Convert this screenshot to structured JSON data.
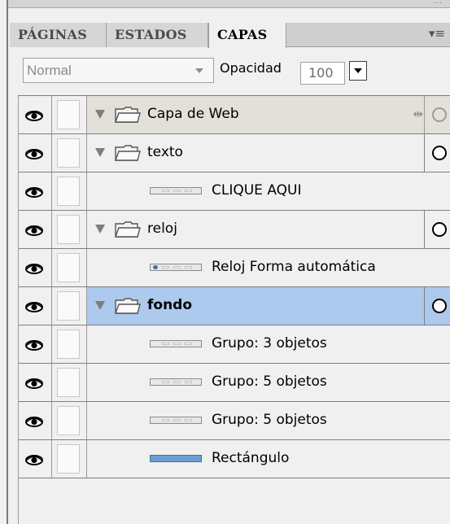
{
  "tabs": [
    {
      "label": "PÁGINAS",
      "active": false
    },
    {
      "label": "ESTADOS",
      "active": false
    },
    {
      "label": "CAPAS",
      "active": true
    }
  ],
  "panel_menu_icon": "panel-options-icon",
  "options": {
    "blend_mode": "Normal",
    "opacity_label": "Opacidad",
    "opacity_value": "100"
  },
  "layers": [
    {
      "type": "folder",
      "name": "Capa de Web",
      "expanded": true
    },
    {
      "type": "folder",
      "name": "texto",
      "expanded": true
    },
    {
      "type": "object",
      "name": "CLIQUE AQUI"
    },
    {
      "type": "folder",
      "name": "reloj",
      "expanded": true
    },
    {
      "type": "object",
      "name": "Reloj Forma automática"
    },
    {
      "type": "folder",
      "name": "fondo",
      "expanded": true,
      "selected": true
    },
    {
      "type": "object",
      "name": "Grupo: 3 objetos"
    },
    {
      "type": "object",
      "name": "Grupo: 5 objetos"
    },
    {
      "type": "object",
      "name": "Grupo: 5 objetos"
    },
    {
      "type": "object",
      "name": "Rectángulo"
    }
  ],
  "colors": {
    "selected_row": "#adc9ee",
    "web_layer_row": "#e3dfd9",
    "rectangle_fill": "#6c9fd4"
  }
}
